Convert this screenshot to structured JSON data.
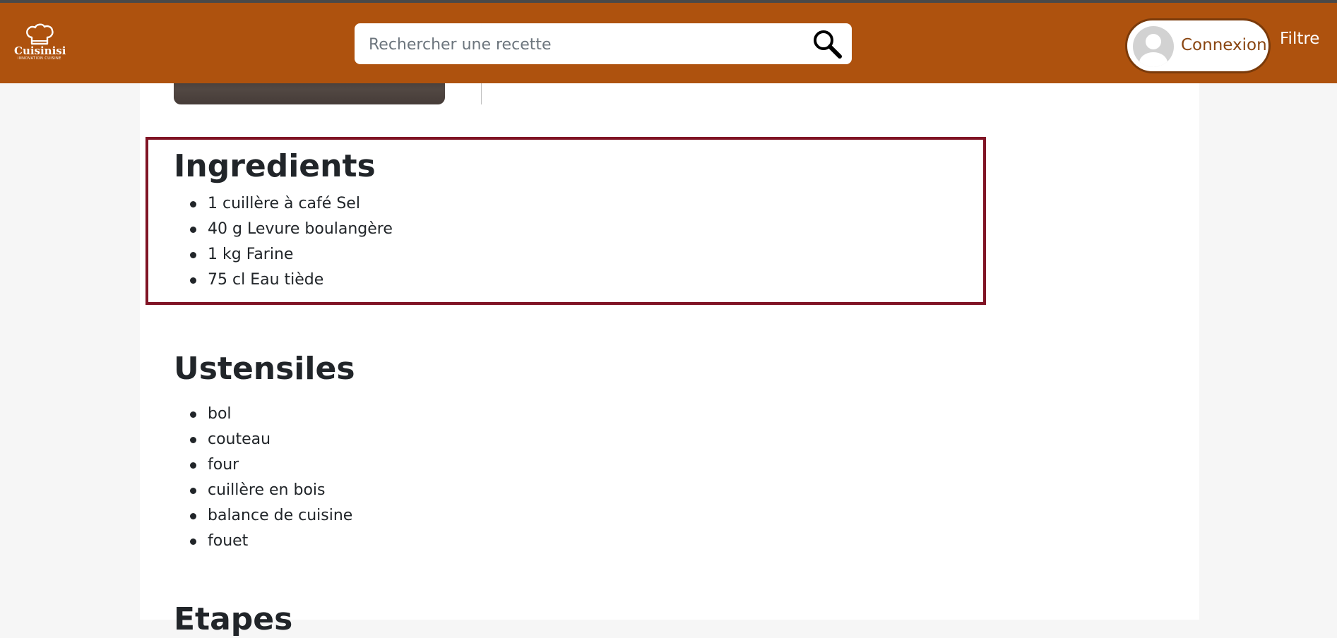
{
  "header": {
    "logo": {
      "name": "Cuisinisi",
      "tagline": "INNOVATION CUISINE",
      "icon": "chef-hat-icon"
    },
    "search": {
      "placeholder": "Rechercher une recette",
      "value": "",
      "icon": "search-icon"
    },
    "login": {
      "label": "Connexion",
      "icon": "avatar-icon"
    },
    "filter_label": "Filtre"
  },
  "colors": {
    "header_bg": "#ae520e",
    "highlight_border": "#801425",
    "page_bg": "#f6f6f6",
    "content_bg": "#ffffff"
  },
  "recipe": {
    "ingredients": {
      "title": "Ingredients",
      "items": [
        "1 cuillère à café Sel",
        "40 g Levure boulangère",
        "1 kg Farine",
        "75 cl Eau tiède"
      ]
    },
    "ustensiles": {
      "title": "Ustensiles",
      "items": [
        "bol",
        "couteau",
        "four",
        "cuillère en bois",
        "balance de cuisine",
        "fouet"
      ]
    },
    "next_section_title": "Etapes"
  }
}
